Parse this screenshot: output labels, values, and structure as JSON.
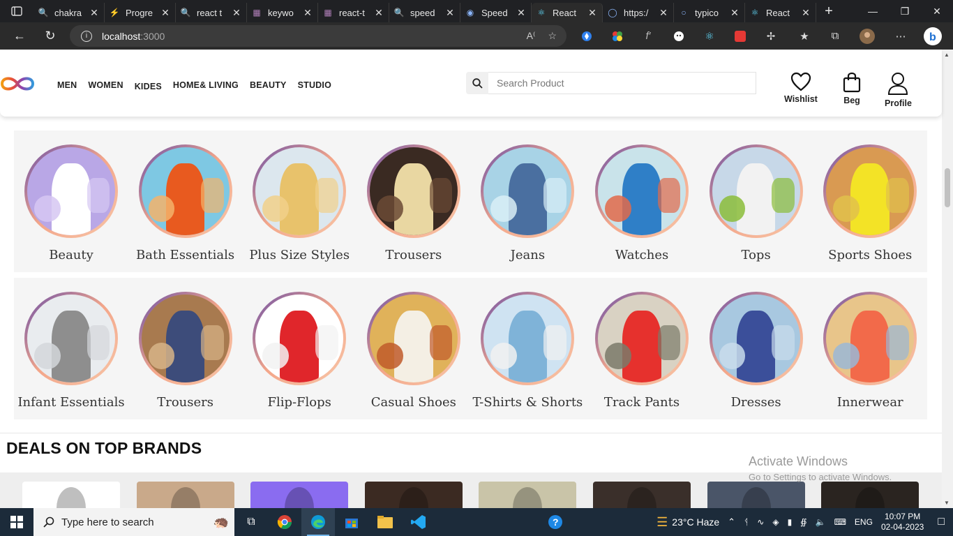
{
  "browser": {
    "tabs": [
      {
        "title": "chakra",
        "icon": "search-icon",
        "active": false
      },
      {
        "title": "Progre",
        "icon": "bolt-icon",
        "active": false
      },
      {
        "title": "react t",
        "icon": "search-icon",
        "active": false
      },
      {
        "title": "keywo",
        "icon": "m-icon",
        "active": false
      },
      {
        "title": "react-t",
        "icon": "m-icon",
        "active": false
      },
      {
        "title": "speed",
        "icon": "search-icon",
        "active": false
      },
      {
        "title": "Speed",
        "icon": "speed-icon",
        "active": false
      },
      {
        "title": "React",
        "icon": "react-icon",
        "active": true
      },
      {
        "title": "https:/",
        "icon": "globe-icon",
        "active": false
      },
      {
        "title": "typico",
        "icon": "github-icon",
        "active": false
      },
      {
        "title": "React",
        "icon": "react-icon",
        "active": false
      }
    ],
    "url_host": "localhost",
    "url_port": ":3000"
  },
  "site": {
    "nav": [
      "MEN",
      "WOMEN",
      "KIDES",
      "HOME& LIVING",
      "BEAUTY",
      "STUDIO"
    ],
    "search_placeholder": "Search Product",
    "header_icons": {
      "wishlist": "Wishlist",
      "bag": "Beg",
      "profile": "Profile"
    },
    "row1": [
      {
        "name": "Beauty",
        "colors": [
          "#b9a7e6",
          "#ffffff",
          "#d6c7f2"
        ]
      },
      {
        "name": "Bath Essentials",
        "colors": [
          "#7ec8e3",
          "#e85a1f",
          "#f3b36b"
        ]
      },
      {
        "name": "Plus Size Styles",
        "colors": [
          "#dce7ee",
          "#e8c26b",
          "#f1d08a"
        ]
      },
      {
        "name": "Trousers",
        "colors": [
          "#3a2a22",
          "#e9d7a2",
          "#6b4a35"
        ]
      },
      {
        "name": "Jeans",
        "colors": [
          "#a8d3e6",
          "#4a6fa0",
          "#d9eef6"
        ]
      },
      {
        "name": "Watches",
        "colors": [
          "#c9e3ea",
          "#2f7fc7",
          "#e26a4a"
        ]
      },
      {
        "name": "Tops",
        "colors": [
          "#c7d8e8",
          "#f2f2f2",
          "#8bbd3a"
        ]
      },
      {
        "name": "Sports Shoes",
        "colors": [
          "#d99a52",
          "#f3e326",
          "#e0c14b"
        ]
      }
    ],
    "row2": [
      {
        "name": "Infant Essentials",
        "colors": [
          "#e9ecef",
          "#8e8e8e",
          "#d4d7db"
        ]
      },
      {
        "name": "Trousers",
        "colors": [
          "#a87a4f",
          "#3d4c7a",
          "#d7b487"
        ]
      },
      {
        "name": "Flip-Flops",
        "colors": [
          "#ffffff",
          "#e0262b",
          "#f2f2f2"
        ]
      },
      {
        "name": "Casual Shoes",
        "colors": [
          "#e0b25a",
          "#f4efe4",
          "#c05a2a"
        ]
      },
      {
        "name": "T-Shirts & Shorts",
        "colors": [
          "#cfe3f2",
          "#7fb3d8",
          "#f1f1f1"
        ]
      },
      {
        "name": "Track Pants",
        "colors": [
          "#d9d2c3",
          "#e6312d",
          "#7a7a6a"
        ]
      },
      {
        "name": "Dresses",
        "colors": [
          "#a8c8e0",
          "#3b4f9a",
          "#c9dceb"
        ]
      },
      {
        "name": "Innerwear",
        "colors": [
          "#e8c58a",
          "#f26a4a",
          "#9ab7d6"
        ]
      }
    ],
    "deals_title": "DEALS ON TOP BRANDS",
    "deal_cards": [
      "#ffffff",
      "#c9a98a",
      "#8a6cf0",
      "#3b2a22",
      "#c9c4a8",
      "#3a2f2a",
      "#4a5568",
      "#2a2420"
    ]
  },
  "overlay": {
    "activate_line1": "Activate Windows",
    "activate_line2": "Go to Settings to activate Windows."
  },
  "taskbar": {
    "search_placeholder": "Type here to search",
    "weather": "23°C  Haze",
    "lang": "ENG",
    "time": "10:07 PM",
    "date": "02-04-2023"
  }
}
